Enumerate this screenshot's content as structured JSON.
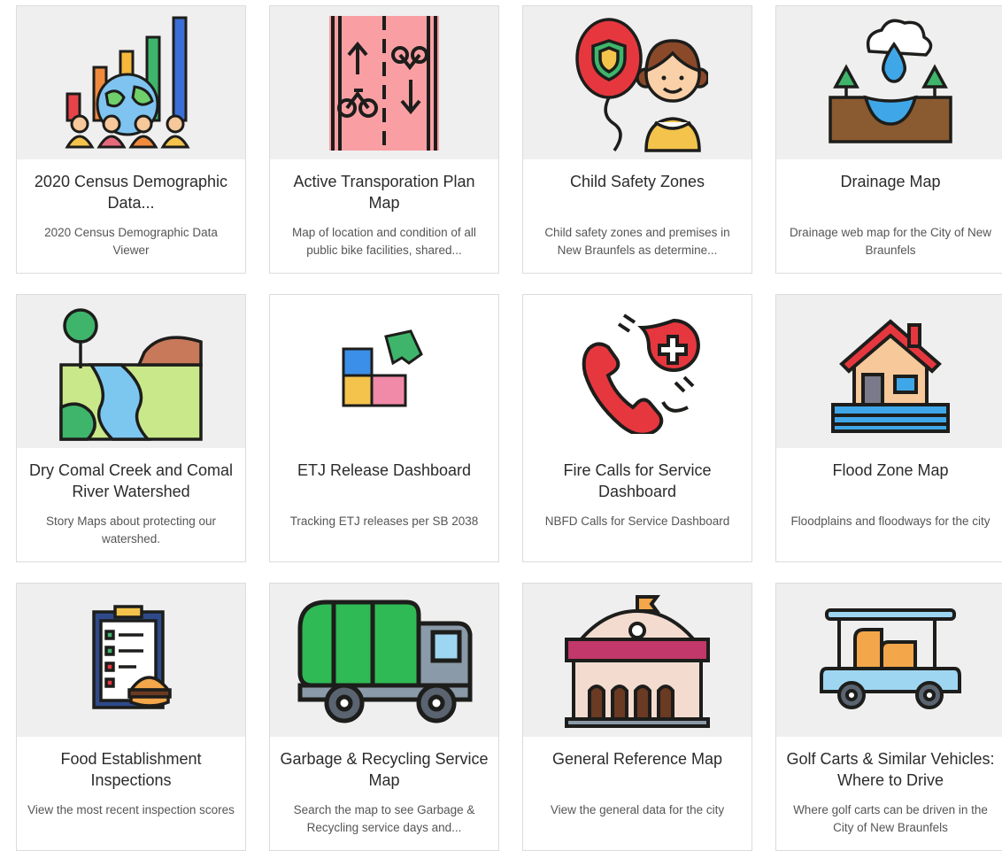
{
  "cards": [
    {
      "title": "2020 Census Demographic Data...",
      "description": "2020 Census Demographic Data Viewer",
      "icon": "census-chart-people-icon"
    },
    {
      "title": "Active Transporation Plan Map",
      "description": "Map of location and condition of all public bike facilities, shared...",
      "icon": "bike-lane-icon"
    },
    {
      "title": "Child Safety Zones",
      "description": "Child safety zones and premises in New Braunfels as determine...",
      "icon": "child-with-balloon-icon"
    },
    {
      "title": "Drainage Map",
      "description": "Drainage web map for the City of New Braunfels",
      "icon": "drainage-rain-icon"
    },
    {
      "title": "Dry Comal Creek and Comal River Watershed",
      "description": "Story Maps about protecting our watershed.",
      "icon": "river-landscape-icon"
    },
    {
      "title": "ETJ Release Dashboard",
      "description": "Tracking ETJ releases per SB 2038",
      "icon": "puzzle-icon"
    },
    {
      "title": "Fire Calls for Service Dashboard",
      "description": "NBFD Calls for Service Dashboard",
      "icon": "emergency-phone-icon"
    },
    {
      "title": "Flood Zone Map",
      "description": "Floodplains and floodways for the city",
      "icon": "flooded-house-icon"
    },
    {
      "title": "Food Establishment Inspections",
      "description": "View the most recent inspection scores",
      "icon": "clipboard-burger-icon"
    },
    {
      "title": "Garbage & Recycling Service Map",
      "description": "Search the map to see Garbage & Recycling service days and...",
      "icon": "garbage-truck-icon"
    },
    {
      "title": "General Reference Map",
      "description": "View the general data for the city",
      "icon": "city-hall-icon"
    },
    {
      "title": "Golf Carts & Similar Vehicles: Where to Drive",
      "description": "Where golf carts can be driven in the City of New Braunfels",
      "icon": "golf-cart-icon"
    }
  ]
}
